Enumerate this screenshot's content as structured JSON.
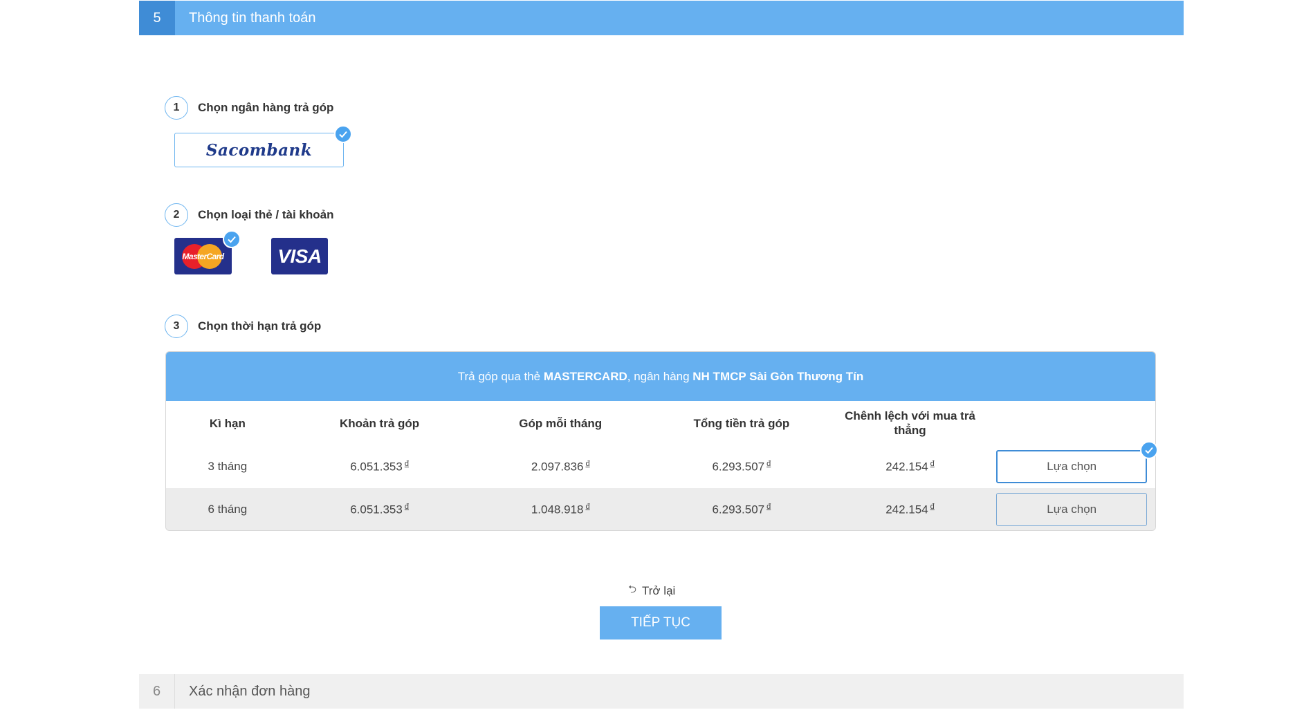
{
  "step5": {
    "number": "5",
    "title": "Thông tin thanh toán"
  },
  "substeps": [
    {
      "number": "1",
      "title": "Chọn ngân hàng trả góp"
    },
    {
      "number": "2",
      "title": "Chọn loại thẻ / tài khoản"
    },
    {
      "number": "3",
      "title": "Chọn thời hạn trả góp"
    }
  ],
  "bank": {
    "name": "Sacombank",
    "selected": true
  },
  "cards": [
    {
      "name": "MasterCard",
      "selected": true
    },
    {
      "name": "VISA",
      "selected": false
    }
  ],
  "installment": {
    "heading_prefix": "Trả góp qua thẻ ",
    "heading_card": "MASTERCARD",
    "heading_middle": ", ngân hàng ",
    "heading_bank": "NH TMCP Sài Gòn Thương Tín",
    "columns": [
      "Kì hạn",
      "Khoản trả góp",
      "Góp mỗi tháng",
      "Tổng tiền trả góp",
      "Chênh lệch với mua trả thẳng"
    ],
    "currency": "đ",
    "rows": [
      {
        "term": "3 tháng",
        "amount": "6.051.353",
        "monthly": "2.097.836",
        "total": "6.293.507",
        "diff": "242.154",
        "button": "Lựa chọn",
        "selected": true
      },
      {
        "term": "6 tháng",
        "amount": "6.051.353",
        "monthly": "1.048.918",
        "total": "6.293.507",
        "diff": "242.154",
        "button": "Lựa chọn",
        "selected": false
      }
    ]
  },
  "actions": {
    "back": "Trở lại",
    "continue": "TIẾP TỤC"
  },
  "step6": {
    "number": "6",
    "title": "Xác nhận đơn hàng"
  },
  "colors": {
    "primary": "#66b0f0",
    "primary_dark": "#3f8cd6",
    "check": "#4aa3ef"
  }
}
